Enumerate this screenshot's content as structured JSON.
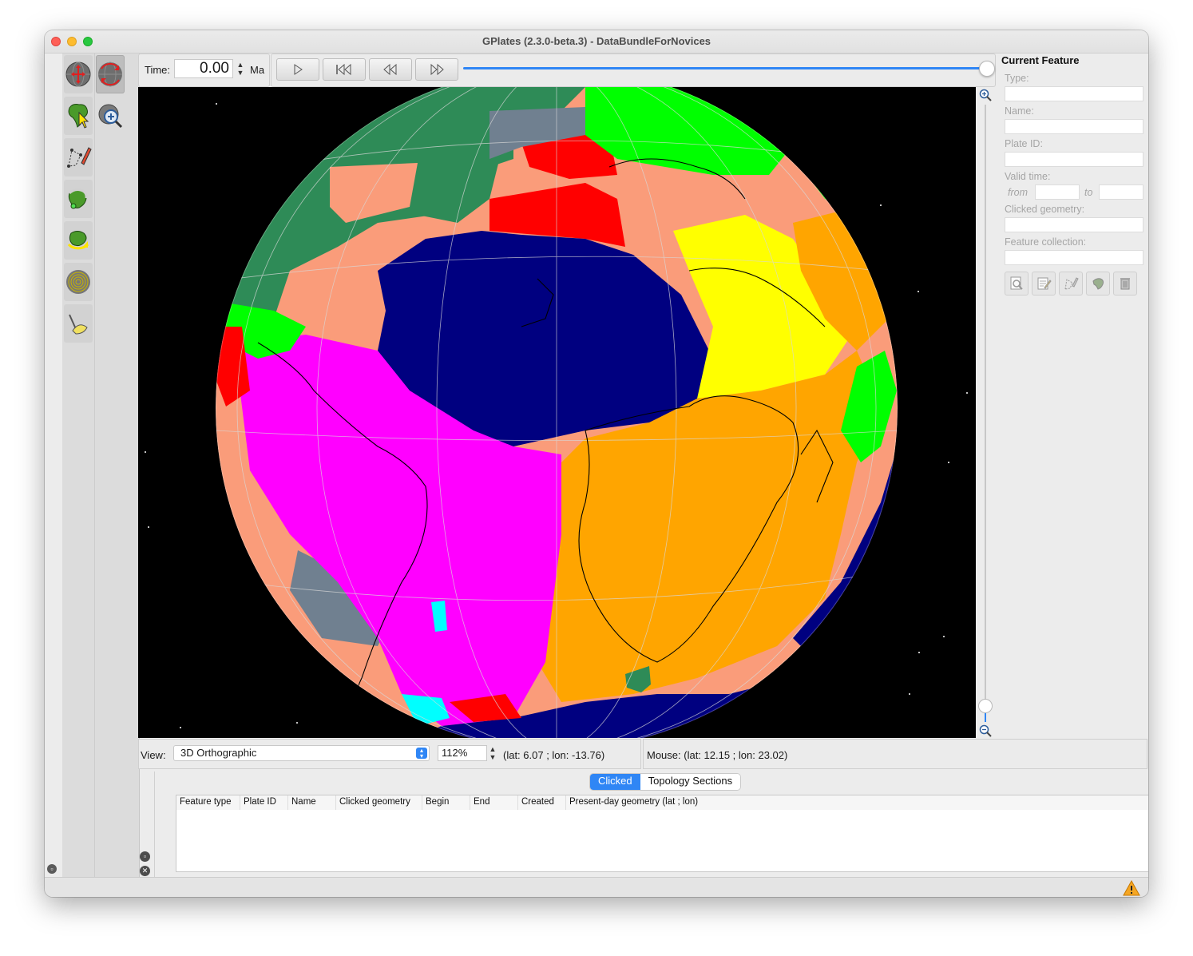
{
  "window": {
    "title": "GPlates (2.3.0-beta.3) - DataBundleForNovices"
  },
  "toolbox": {
    "tools": [
      {
        "name": "drag-globe-tool-icon",
        "selected": false
      },
      {
        "name": "rotate-globe-tool-icon",
        "selected": true
      },
      {
        "name": "choose-feature-tool-icon",
        "selected": false
      },
      {
        "name": "zoom-tool-icon",
        "selected": false
      },
      {
        "name": "digitise-geometry-tool-icon",
        "selected": false
      },
      {
        "name": "topology-tool-icon",
        "selected": false
      },
      {
        "name": "reconstruction-pole-tool-icon",
        "selected": false
      },
      {
        "name": "scalar-field-tool-icon",
        "selected": false
      },
      {
        "name": "small-circle-tool-icon",
        "selected": false
      }
    ]
  },
  "timebar": {
    "time_label": "Time:",
    "time_value": "0.00",
    "time_unit": "Ma",
    "slider_fraction": 1.0
  },
  "animation": {
    "buttons": [
      {
        "name": "play-button",
        "icon": "play-icon"
      },
      {
        "name": "reset-to-start-button",
        "icon": "skip-to-start-icon"
      },
      {
        "name": "step-back-button",
        "icon": "step-back-icon"
      },
      {
        "name": "step-forward-button",
        "icon": "step-forward-icon"
      }
    ]
  },
  "feature_panel": {
    "title": "Current Feature",
    "type_label": "Type:",
    "name_label": "Name:",
    "plate_id_label": "Plate ID:",
    "valid_time_label": "Valid time:",
    "from_label": "from",
    "to_label": "to",
    "clicked_geometry_label": "Clicked geometry:",
    "feature_collection_label": "Feature collection:",
    "actions": [
      "query-feature-icon",
      "edit-feature-icon",
      "digitise-icon",
      "clone-feature-icon",
      "delete-feature-icon"
    ]
  },
  "viewbar": {
    "view_label": "View:",
    "projection": "3D Orthographic",
    "zoom": "112%",
    "camera_coords": "(lat: 6.07 ; lon: -13.76)"
  },
  "mousebar": {
    "mouse_coords": "Mouse: (lat: 12.15 ; lon: 23.02)"
  },
  "dock": {
    "tabs": [
      {
        "label": "Clicked",
        "active": true
      },
      {
        "label": "Topology Sections",
        "active": false
      }
    ],
    "columns": [
      "Feature type",
      "Plate ID",
      "Name",
      "Clicked geometry",
      "Begin",
      "End",
      "Created",
      "Present-day geometry (lat ; lon)"
    ]
  },
  "colors": {
    "accent": "#2f86f5",
    "globe_navy": "#000080",
    "globe_magenta": "#ff00ff",
    "globe_orange": "#ffa500",
    "globe_yellow": "#ffff00",
    "globe_seagreen": "#2e8b57",
    "globe_salmon": "#fa9c7a",
    "globe_red": "#ff0000",
    "globe_gray": "#708090",
    "globe_lime": "#00ff00",
    "globe_cyan": "#00ffff"
  }
}
